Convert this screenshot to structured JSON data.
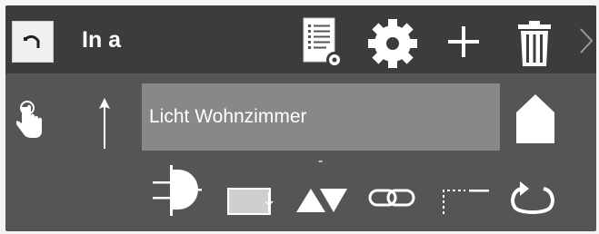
{
  "header": {
    "title": "In a"
  },
  "row2": {
    "name_value": "Licht Wohnzimmer"
  },
  "row3": {
    "tri_label": "-"
  },
  "icons": {
    "logo": "curve-arrow-icon",
    "list": "list-settings-icon",
    "gear": "gear-icon",
    "add": "plus-icon",
    "delete": "trash-icon",
    "next": "chevron-right-icon",
    "touch": "touch-hand-icon",
    "arrow": "arrow-up-icon",
    "home": "home-icon",
    "gate": "and-gate-icon",
    "box": "delay-box-icon",
    "tri": "triangles-icon",
    "link": "link-icon",
    "line": "dotted-line-icon",
    "loop": "loop-icon"
  },
  "colors": {
    "panel": "#555555",
    "header": "#3c3c3c",
    "field": "#888888",
    "icon": "#ffffff"
  }
}
